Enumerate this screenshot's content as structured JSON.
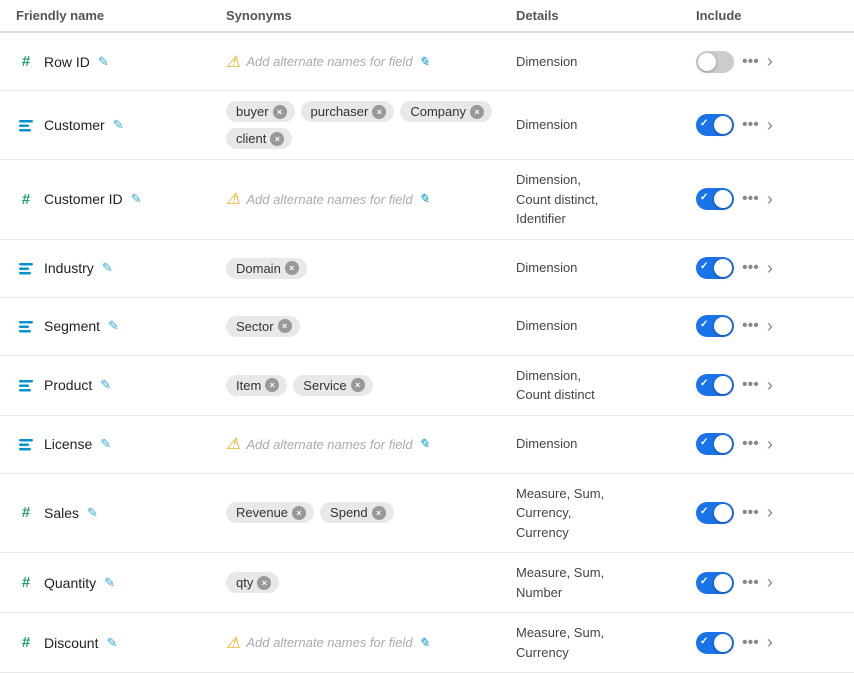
{
  "header": {
    "col1": "Friendly name",
    "col2": "Synonyms",
    "col3": "Details",
    "col4": "Include"
  },
  "rows": [
    {
      "id": "row-id",
      "icon": "hash",
      "name": "Row ID",
      "synonyms": [],
      "synonyms_placeholder": "Add alternate names for field",
      "details": "Dimension",
      "include": false
    },
    {
      "id": "customer",
      "icon": "text",
      "name": "Customer",
      "synonyms": [
        "buyer",
        "purchaser",
        "Company",
        "client"
      ],
      "synonyms_placeholder": null,
      "details": "Dimension",
      "include": true
    },
    {
      "id": "customer-id",
      "icon": "hash",
      "name": "Customer ID",
      "synonyms": [],
      "synonyms_placeholder": "Add alternate names for field",
      "details": "Dimension,\nCount distinct,\nIdentifier",
      "include": true
    },
    {
      "id": "industry",
      "icon": "text",
      "name": "Industry",
      "synonyms": [
        "Domain"
      ],
      "synonyms_placeholder": null,
      "details": "Dimension",
      "include": true
    },
    {
      "id": "segment",
      "icon": "text",
      "name": "Segment",
      "synonyms": [
        "Sector"
      ],
      "synonyms_placeholder": null,
      "details": "Dimension",
      "include": true
    },
    {
      "id": "product",
      "icon": "text",
      "name": "Product",
      "synonyms": [
        "Item",
        "Service"
      ],
      "synonyms_placeholder": null,
      "details": "Dimension,\nCount distinct",
      "include": true
    },
    {
      "id": "license",
      "icon": "text",
      "name": "License",
      "synonyms": [],
      "synonyms_placeholder": "Add alternate names for field",
      "details": "Dimension",
      "include": true
    },
    {
      "id": "sales",
      "icon": "hash",
      "name": "Sales",
      "synonyms": [
        "Revenue",
        "Spend"
      ],
      "synonyms_placeholder": null,
      "details": "Measure, Sum,\nCurrency,\nCurrency",
      "include": true
    },
    {
      "id": "quantity",
      "icon": "hash",
      "name": "Quantity",
      "synonyms": [
        "qty"
      ],
      "synonyms_placeholder": null,
      "details": "Measure, Sum,\nNumber",
      "include": true
    },
    {
      "id": "discount",
      "icon": "hash",
      "name": "Discount",
      "synonyms": [],
      "synonyms_placeholder": "Add alternate names for field",
      "details": "Measure, Sum,\nCurrency",
      "include": true
    }
  ],
  "icons": {
    "hash": "#",
    "text": "T",
    "edit": "✎",
    "warning": "⚠",
    "more": "•••",
    "chevron": "›",
    "check": "✓",
    "remove": "×"
  }
}
